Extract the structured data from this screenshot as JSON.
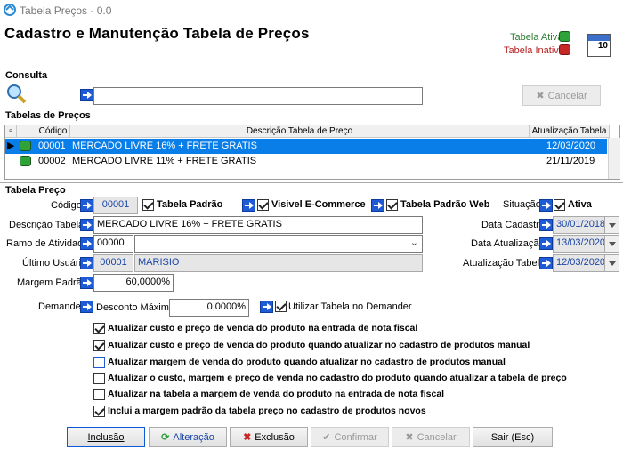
{
  "window": {
    "title": "Tabela Preços - 0.0"
  },
  "header": {
    "title": "Cadastro e Manutenção Tabela de Preços",
    "legend_active": "Tabela Ativa",
    "legend_inactive": "Tabela Inativa",
    "calendar_day": "10",
    "colors": {
      "active": "#2fa33a",
      "inactive": "#c62828",
      "accent": "#1e5bd4",
      "selected_row": "#0a7ee8"
    }
  },
  "consulta": {
    "section": "Consulta",
    "search_value": "",
    "cancel_label": "Cancelar"
  },
  "tabelas": {
    "section": "Tabelas de Preços",
    "columns": [
      "Código",
      "Descrição Tabela de Preço",
      "Atualização Tabela"
    ],
    "rows": [
      {
        "codigo": "00001",
        "descricao": "MERCADO LIVRE 16% + FRETE GRATIS",
        "atualizacao": "12/03/2020",
        "status": "active"
      },
      {
        "codigo": "00002",
        "descricao": "MERCADO LIVRE 11% + FRETE GRATIS",
        "atualizacao": "21/11/2019",
        "status": "active"
      }
    ]
  },
  "form": {
    "section": "Tabela Preço",
    "codigo_label": "Código:",
    "codigo_value": "00001",
    "tabela_padrao": "Tabela Padrão",
    "visivel_ecommerce": "Visivel E-Commerce",
    "tabela_padrao_web": "Tabela Padrão Web",
    "situacao_label": "Situação:",
    "ativa": "Ativa",
    "descricao_label": "Descrição Tabela:",
    "descricao_value": "MERCADO LIVRE 16% + FRETE GRATIS",
    "ramo_label": "Ramo de Atividade:",
    "ramo_code": "00000",
    "ramo_value": "",
    "ultimo_usuario_label": "Último Usuário:",
    "usuario_code": "00001",
    "usuario_name": "MARISIO",
    "margem_label": "Margem Padrão:",
    "margem_value": "60,0000%",
    "demander_label": "Demander:",
    "desconto_label": "Desconto Máximo:",
    "desconto_value": "0,0000%",
    "utilizar_demander": "Utilizar Tabela no Demander",
    "data_cadastro_label": "Data Cadastro:",
    "data_cadastro": "30/01/2018",
    "data_atualizacao_label": "Data Atualização:",
    "data_atualizacao": "13/03/2020",
    "atualizacao_tabela_label": "Atualização Tabela:",
    "atualizacao_tabela": "12/03/2020"
  },
  "options": [
    {
      "label": "Atualizar custo e preço de venda do produto na entrada de nota fiscal",
      "checked": true
    },
    {
      "label": "Atualizar custo e preço de venda do produto quando atualizar no cadastro de produtos manual",
      "checked": true
    },
    {
      "label": "Atualizar margem de venda do produto quando atualizar no cadastro de produtos manual",
      "checked": false
    },
    {
      "label": "Atualizar o custo, margem e preço de venda no cadastro do produto quando atualizar a tabela de preço",
      "checked": false
    },
    {
      "label": "Atualizar na tabela a margem de venda do produto na entrada de nota fiscal",
      "checked": false
    },
    {
      "label": "Inclui a margem padrão da tabela preço no cadastro de produtos novos",
      "checked": true
    }
  ],
  "footer": {
    "incluir": "Inclusão",
    "alterar": "Alteração",
    "excluir": "Exclusão",
    "confirmar": "Confirmar",
    "cancelar": "Cancelar",
    "sair": "Sair (Esc)"
  }
}
